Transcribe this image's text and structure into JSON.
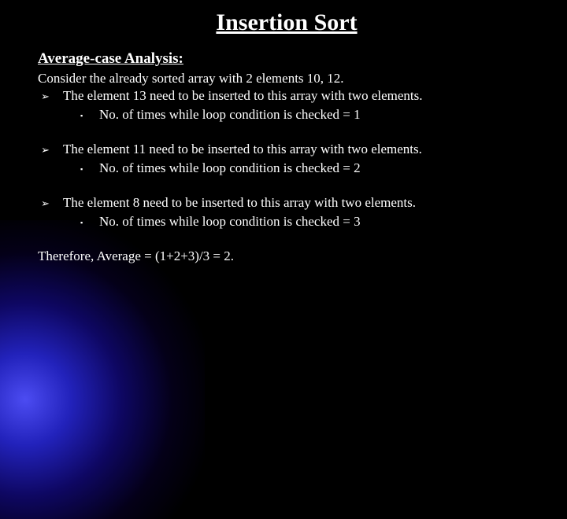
{
  "title": "Insertion Sort",
  "subhead": "Average-case Analysis:",
  "intro": "Consider the already sorted array with 2 elements 10, 12.",
  "items": [
    {
      "text": "The element 13 need to be inserted to this array with two elements.",
      "sub": "No. of times while loop condition is checked = 1"
    },
    {
      "text": "The element 11 need to be inserted to this array with two elements.",
      "sub": "No. of times while loop condition is checked = 2"
    },
    {
      "text": "The element 8 need to be inserted to this array with two elements.",
      "sub": "No. of times while loop condition is checked = 3"
    }
  ],
  "therefore": "Therefore, Average = (1+2+3)/3  = 2."
}
